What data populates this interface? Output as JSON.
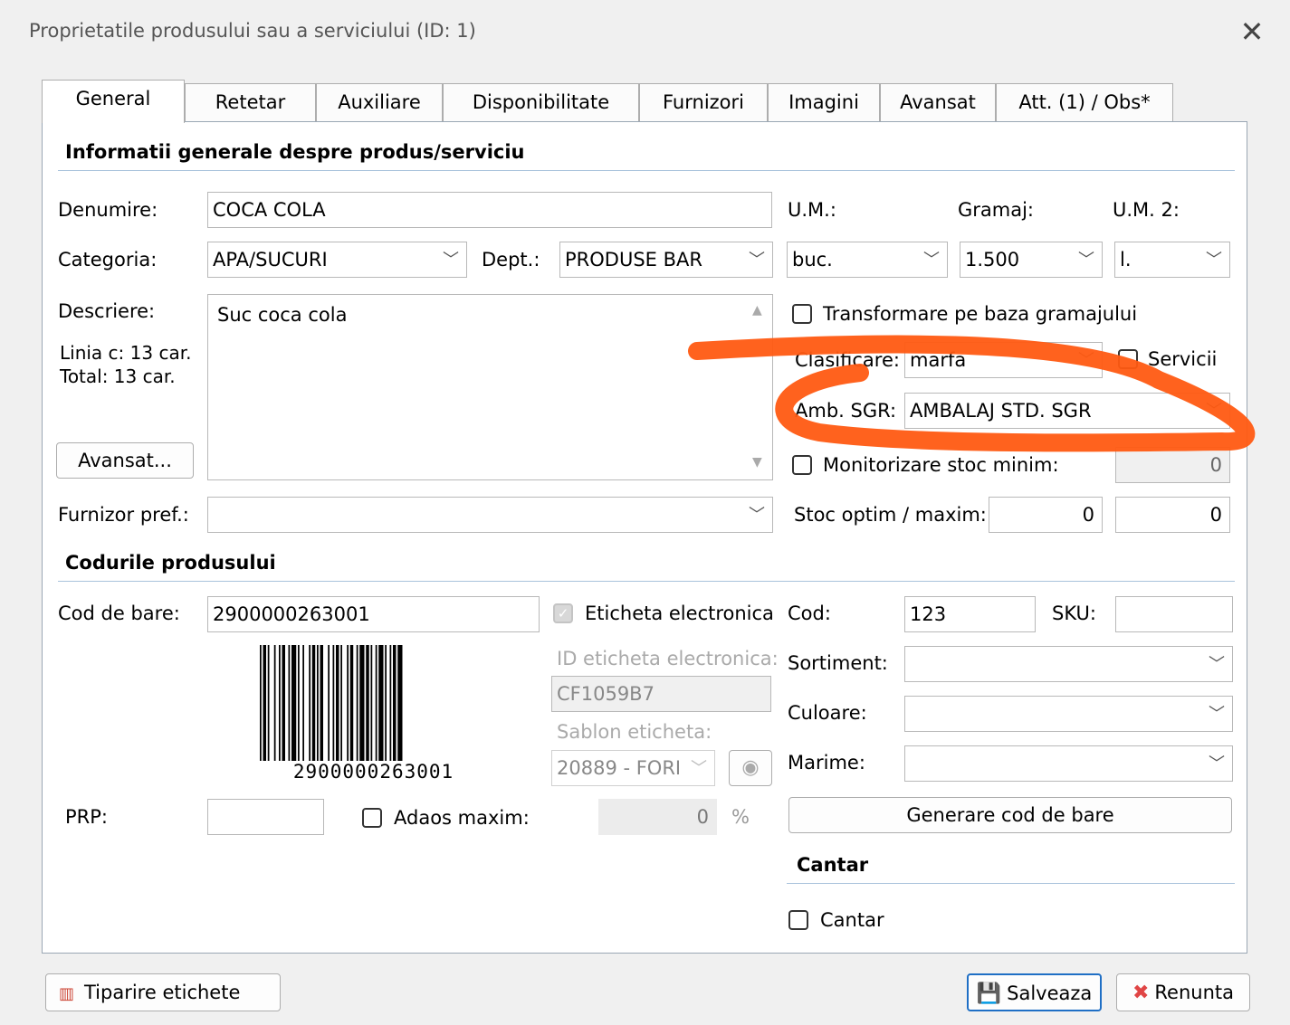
{
  "window": {
    "title": "Proprietatile produsului sau a serviciului (ID: 1)"
  },
  "tabs": [
    "General",
    "Retetar",
    "Auxiliare",
    "Disponibilitate",
    "Furnizori",
    "Imagini",
    "Avansat",
    "Att. (1) / Obs*"
  ],
  "general_section": {
    "title": "Informatii generale despre produs/serviciu",
    "denumire_label": "Denumire:",
    "denumire_value": "COCA COLA",
    "um_label": "U.M.:",
    "gramaj_label": "Gramaj:",
    "um2_label": "U.M. 2:",
    "categoria_label": "Categoria:",
    "categoria_value": "APA/SUCURI",
    "dept_label": "Dept.:",
    "dept_value": "PRODUSE BAR",
    "um_value": "buc.",
    "gramaj_value": "1.500",
    "um2_value": "l.",
    "descriere_label": "Descriere:",
    "descriere_value": "Suc coca cola",
    "linia_info": "Linia c: 13 car.",
    "total_info": "Total: 13 car.",
    "avansat_button": "Avansat...",
    "transformare_label": "Transformare pe baza gramajului",
    "clasificare_label": "Clasificare:",
    "clasificare_value": "marfa",
    "servicii_label": "Servicii",
    "amb_sgr_label": "Amb. SGR:",
    "amb_sgr_value": "AMBALAJ STD. SGR",
    "monitorizare_label": "Monitorizare stoc minim:",
    "stoc_minim_value": "0",
    "furnizor_label": "Furnizor pref.:",
    "furnizor_value": "",
    "stoc_label": "Stoc optim / maxim:",
    "stoc_optim_value": "0",
    "stoc_maxim_value": "0"
  },
  "codes_section": {
    "title": "Codurile produsului",
    "cod_bare_label": "Cod de bare:",
    "cod_bare_value": "2900000263001",
    "barcode_text": "2900000263001",
    "eticheta_label": "Eticheta electronica",
    "id_eticheta_label": "ID eticheta electronica:",
    "id_eticheta_value": "CF1059B7",
    "sablon_label": "Sablon eticheta:",
    "sablon_value": "20889 - FORI",
    "cod_label": "Cod:",
    "cod_value": "123",
    "sku_label": "SKU:",
    "sku_value": "",
    "sortiment_label": "Sortiment:",
    "culoare_label": "Culoare:",
    "marime_label": "Marime:",
    "prp_label": "PRP:",
    "prp_value": "",
    "adaos_label": "Adaos maxim:",
    "adaos_value": "0",
    "percent": "%",
    "generare_button": "Generare cod de bare"
  },
  "cantar_section": {
    "title": "Cantar",
    "cantar_label": "Cantar"
  },
  "footer": {
    "tiparire_button": "Tiparire etichete",
    "salveaza_button": "Salveaza",
    "renunta_button": "Renunta"
  },
  "colors": {
    "annotation": "#ff5a12",
    "accent": "#1f6fc5",
    "cancel": "#e04545"
  }
}
